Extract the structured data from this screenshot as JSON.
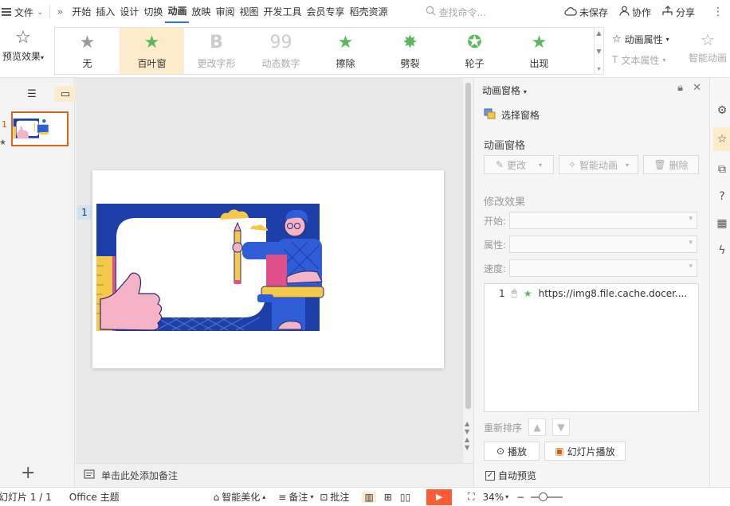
{
  "menu": {
    "file": "文件",
    "tabs": [
      "开始",
      "插入",
      "设计",
      "切换",
      "动画",
      "放映",
      "审阅",
      "视图",
      "开发工具",
      "会员专享",
      "稻壳资源"
    ],
    "active_tab": "动画",
    "search_placeholder": "查找命令...",
    "unsaved": "未保存",
    "collab": "协作",
    "share": "分享"
  },
  "ribbon": {
    "preview": "预览效果",
    "effects": [
      {
        "label": "无",
        "icon": "gray-star-icon",
        "selected": false,
        "disabled": false
      },
      {
        "label": "百叶窗",
        "icon": "blinds-star-icon",
        "selected": true,
        "disabled": false
      },
      {
        "label": "更改字形",
        "icon": "bold-b-icon",
        "selected": false,
        "disabled": true
      },
      {
        "label": "动态数字",
        "icon": "number-99-icon",
        "selected": false,
        "disabled": true
      },
      {
        "label": "擦除",
        "icon": "wipe-star-icon",
        "selected": false,
        "disabled": false
      },
      {
        "label": "劈裂",
        "icon": "split-star-icon",
        "selected": false,
        "disabled": false
      },
      {
        "label": "轮子",
        "icon": "wheel-star-icon",
        "selected": false,
        "disabled": false
      },
      {
        "label": "出现",
        "icon": "appear-star-icon",
        "selected": false,
        "disabled": false
      }
    ],
    "anim_props": "动画属性",
    "text_props": "文本属性",
    "smart_anim": "智能动画"
  },
  "thumbs": {
    "slide_number": "1"
  },
  "slide": {
    "tag": "1"
  },
  "notes": {
    "placeholder": "单击此处添加备注"
  },
  "pane": {
    "title": "动画窗格",
    "select_window": "选择窗格",
    "section1": "动画窗格",
    "btn_change": "更改",
    "btn_smart": "智能动画",
    "btn_delete": "删除",
    "section2": "修改效果",
    "start_label": "开始:",
    "prop_label": "属性:",
    "speed_label": "速度:",
    "list_items": [
      {
        "index": "1",
        "text": "https://img8.file.cache.docer...."
      }
    ],
    "reorder": "重新排序",
    "play": "播放",
    "slideshow": "幻灯片播放",
    "auto_preview": "自动预览",
    "auto_checked": "✓"
  },
  "status": {
    "slide_info": "幻灯片 1 / 1",
    "theme": "Office 主题",
    "beautify": "智能美化",
    "notes": "备注",
    "comments": "批注",
    "zoom": "34%"
  },
  "colors": {
    "accent": "#2f6fe0",
    "selected_bg": "#fdebcc",
    "thumb_border": "#d4691e",
    "play_red": "#ff5a36"
  }
}
